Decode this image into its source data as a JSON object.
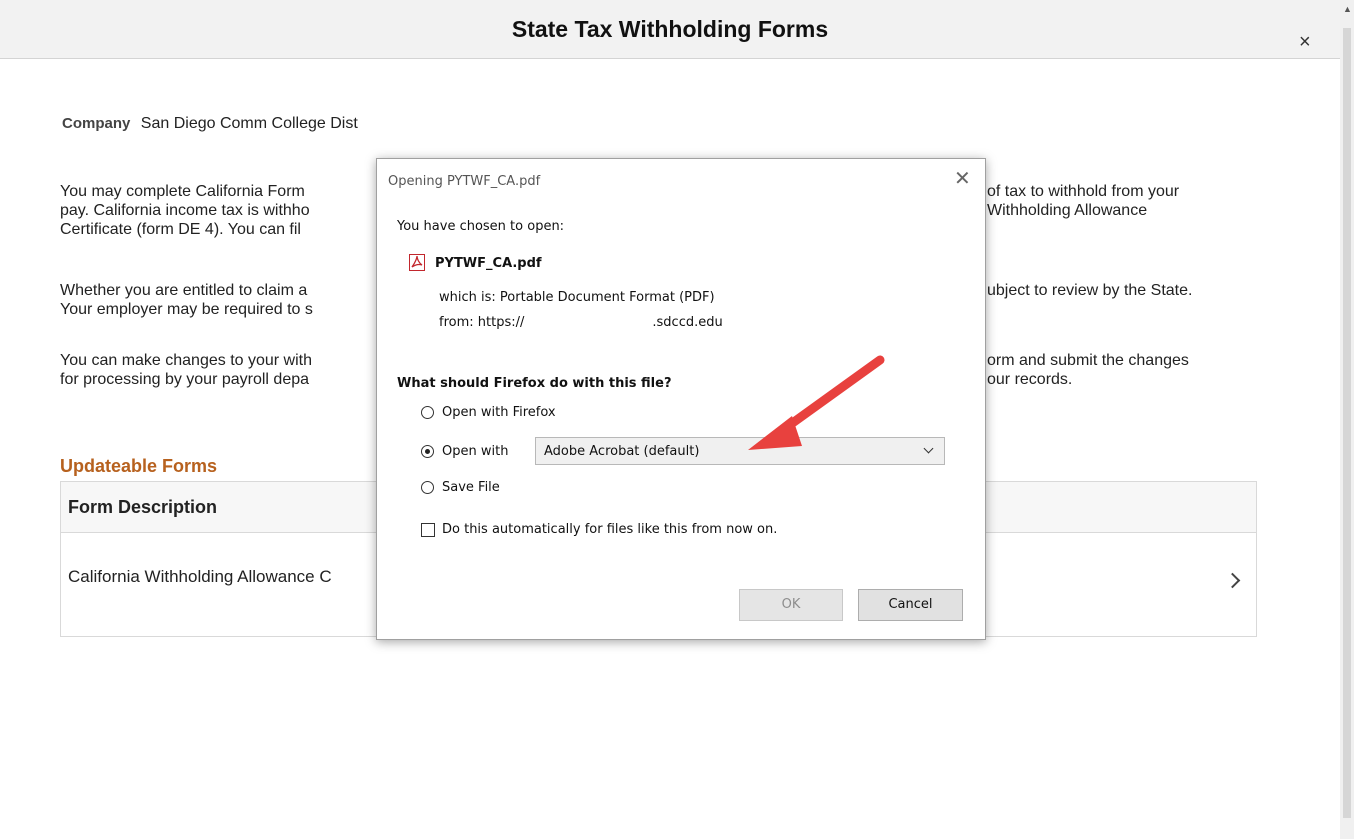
{
  "header": {
    "title": "State Tax Withholding Forms",
    "close_glyph": "×"
  },
  "company": {
    "label": "Company",
    "value": "San Diego Comm College Dist"
  },
  "paragraphs": {
    "p1_left_1": "You may complete California Form",
    "p1_left_2": "pay.  California income tax is withho",
    "p1_left_3": "Certificate (form DE 4).  You can fil",
    "p1_right_1": "of tax to withhold from your",
    "p1_right_2": "Withholding Allowance",
    "p2_left_1": "Whether you are entitled to claim a",
    "p2_left_2": "Your employer may be required to s",
    "p2_right_1": "ubject to review by the State.",
    "p3_left_1": "You can make changes to your with",
    "p3_left_2": "for processing by your payroll depa",
    "p3_right_1": "orm and submit the changes",
    "p3_right_2": "our records."
  },
  "forms": {
    "section_title": "Updateable Forms",
    "column_header": "Form Description",
    "row_text": "California Withholding Allowance C"
  },
  "dialog": {
    "title": "Opening PYTWF_CA.pdf",
    "close_glyph": "✕",
    "chosen_label": "You have chosen to open:",
    "file_name": "PYTWF_CA.pdf",
    "which_is_label": "which is:",
    "which_is_value": "Portable Document Format (PDF)",
    "from_label": "from:",
    "from_prefix": "https://",
    "from_suffix": ".sdccd.edu",
    "question": "What should Firefox do with this file?",
    "option_open_firefox": "Open with Firefox",
    "option_open_with": "Open with",
    "option_save_file": "Save File",
    "selected_app": "Adobe Acrobat (default)",
    "auto_checkbox": "Do this automatically for files like this from now on.",
    "ok_label": "OK",
    "cancel_label": "Cancel"
  },
  "colors": {
    "accent_orange": "#b7611e",
    "arrow_red": "#e8413e"
  }
}
